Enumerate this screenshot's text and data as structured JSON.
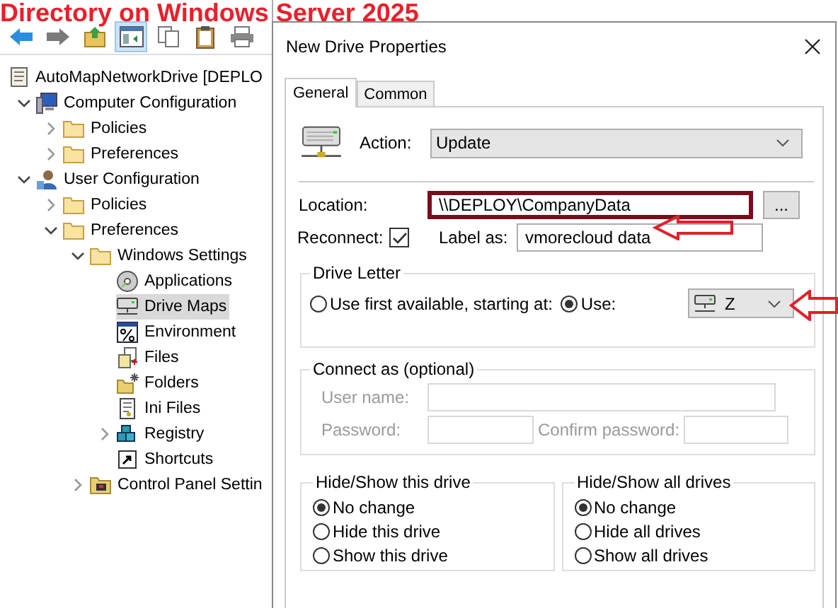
{
  "caption": "Directory on Windows Server 2025",
  "toolbar": [
    {
      "kind": "back",
      "pressed": false
    },
    {
      "kind": "forward",
      "pressed": false
    },
    {
      "kind": "up",
      "pressed": false
    },
    {
      "kind": "tree",
      "pressed": true
    },
    {
      "kind": "copy",
      "pressed": false
    },
    {
      "kind": "paste",
      "pressed": false
    },
    {
      "kind": "print",
      "pressed": false
    }
  ],
  "tree": [
    {
      "label": "AutoMapNetworkDrive [DEPLO",
      "kind": "script",
      "selected": false,
      "children": [
        {
          "label": "Computer Configuration",
          "kind": "computer",
          "expanded": true,
          "selected": false,
          "children": [
            {
              "label": "Policies",
              "kind": "folder",
              "expanded": false,
              "selected": false
            },
            {
              "label": "Preferences",
              "kind": "folder",
              "expanded": false,
              "selected": false
            }
          ]
        },
        {
          "label": "User Configuration",
          "kind": "user",
          "expanded": true,
          "selected": false,
          "children": [
            {
              "label": "Policies",
              "kind": "folder",
              "expanded": false,
              "selected": false
            },
            {
              "label": "Preferences",
              "kind": "folder",
              "expanded": true,
              "selected": false,
              "children": [
                {
                  "label": "Windows Settings",
                  "kind": "folder",
                  "expanded": true,
                  "selected": false,
                  "children": [
                    {
                      "label": "Applications",
                      "kind": "disc",
                      "selected": false
                    },
                    {
                      "label": "Drive Maps",
                      "kind": "drive",
                      "selected": true
                    },
                    {
                      "label": "Environment",
                      "kind": "percent",
                      "selected": false
                    },
                    {
                      "label": "Files",
                      "kind": "files",
                      "selected": false
                    },
                    {
                      "label": "Folders",
                      "kind": "folders",
                      "selected": false
                    },
                    {
                      "label": "Ini Files",
                      "kind": "ini",
                      "selected": false
                    },
                    {
                      "label": "Registry",
                      "kind": "registry",
                      "expanded": false,
                      "selected": false
                    },
                    {
                      "label": "Shortcuts",
                      "kind": "shortcut",
                      "selected": false
                    }
                  ]
                },
                {
                  "label": "Control Panel Settin",
                  "kind": "control",
                  "expanded": false,
                  "selected": false
                }
              ]
            }
          ]
        }
      ]
    }
  ],
  "dialog": {
    "title": "New Drive Properties",
    "tabs": [
      {
        "label": "General",
        "selected": true
      },
      {
        "label": "Common",
        "selected": false
      }
    ],
    "action": {
      "label": "Action:",
      "value": "Update"
    },
    "location": {
      "label": "Location:",
      "value": "\\\\DEPLOY\\CompanyData",
      "highlighted": true,
      "browse": "..."
    },
    "reconnect": {
      "label": "Reconnect:",
      "checked": true
    },
    "label_as": {
      "label": "Label as:",
      "value": "vmorecloud data"
    },
    "drive_letter": {
      "title": "Drive Letter",
      "options": [
        {
          "label": "Use first available, starting at:",
          "selected": false
        },
        {
          "label": "Use:",
          "selected": true
        }
      ],
      "drive": "Z"
    },
    "connect_as": {
      "title": "Connect as (optional)",
      "disabled": true,
      "user_label": "User name:",
      "password_label": "Password:",
      "confirm_label": "Confirm password:"
    },
    "hide_this": {
      "title": "Hide/Show this drive",
      "options": [
        {
          "label": "No change",
          "selected": true
        },
        {
          "label": "Hide this drive",
          "selected": false
        },
        {
          "label": "Show this drive",
          "selected": false
        }
      ]
    },
    "hide_all": {
      "title": "Hide/Show all drives",
      "options": [
        {
          "label": "No change",
          "selected": true
        },
        {
          "label": "Hide all drives",
          "selected": false
        },
        {
          "label": "Show all drives",
          "selected": false
        }
      ]
    }
  }
}
